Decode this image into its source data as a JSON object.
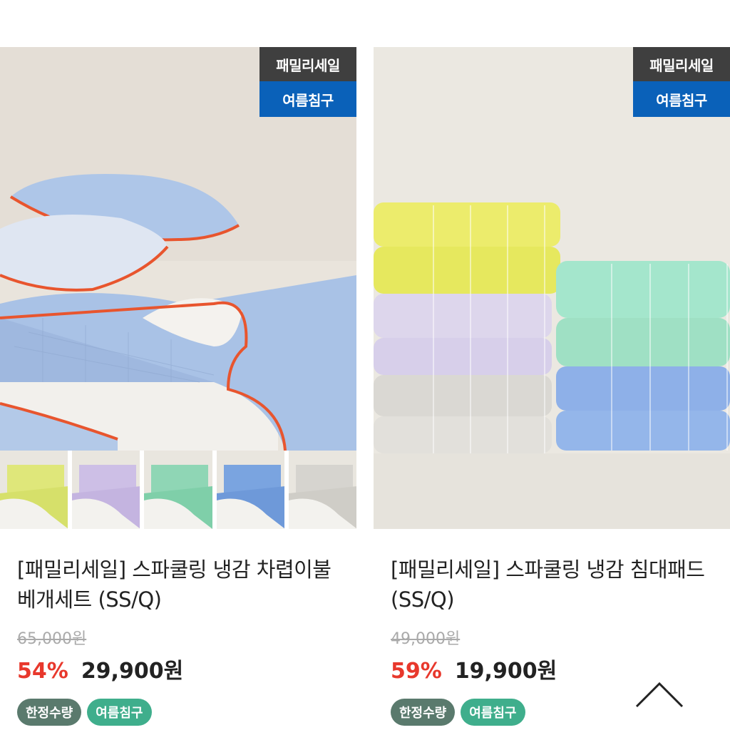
{
  "products": [
    {
      "badge_top": "패밀리세일",
      "badge_bottom": "여름침구",
      "title": "[패밀리세일] 스파쿨링 냉감 차렵이불 베개세트 (SS/Q)",
      "original_price": "65,000원",
      "discount": "54%",
      "sale_price": "29,900원",
      "tags": [
        "한정수량",
        "여름침구"
      ],
      "thumbnail_colors": [
        "#dfe77a",
        "#cdbfe6",
        "#8fd6b5",
        "#7aa4e0",
        "#d6d4cf"
      ]
    },
    {
      "badge_top": "패밀리세일",
      "badge_bottom": "여름침구",
      "title": "[패밀리세일] 스파쿨링 냉감 침대패드 (SS/Q)",
      "original_price": "49,000원",
      "discount": "59%",
      "sale_price": "19,900원",
      "tags": [
        "한정수량",
        "여름침구"
      ]
    }
  ],
  "scroll_top_icon": "chevron-up-icon"
}
